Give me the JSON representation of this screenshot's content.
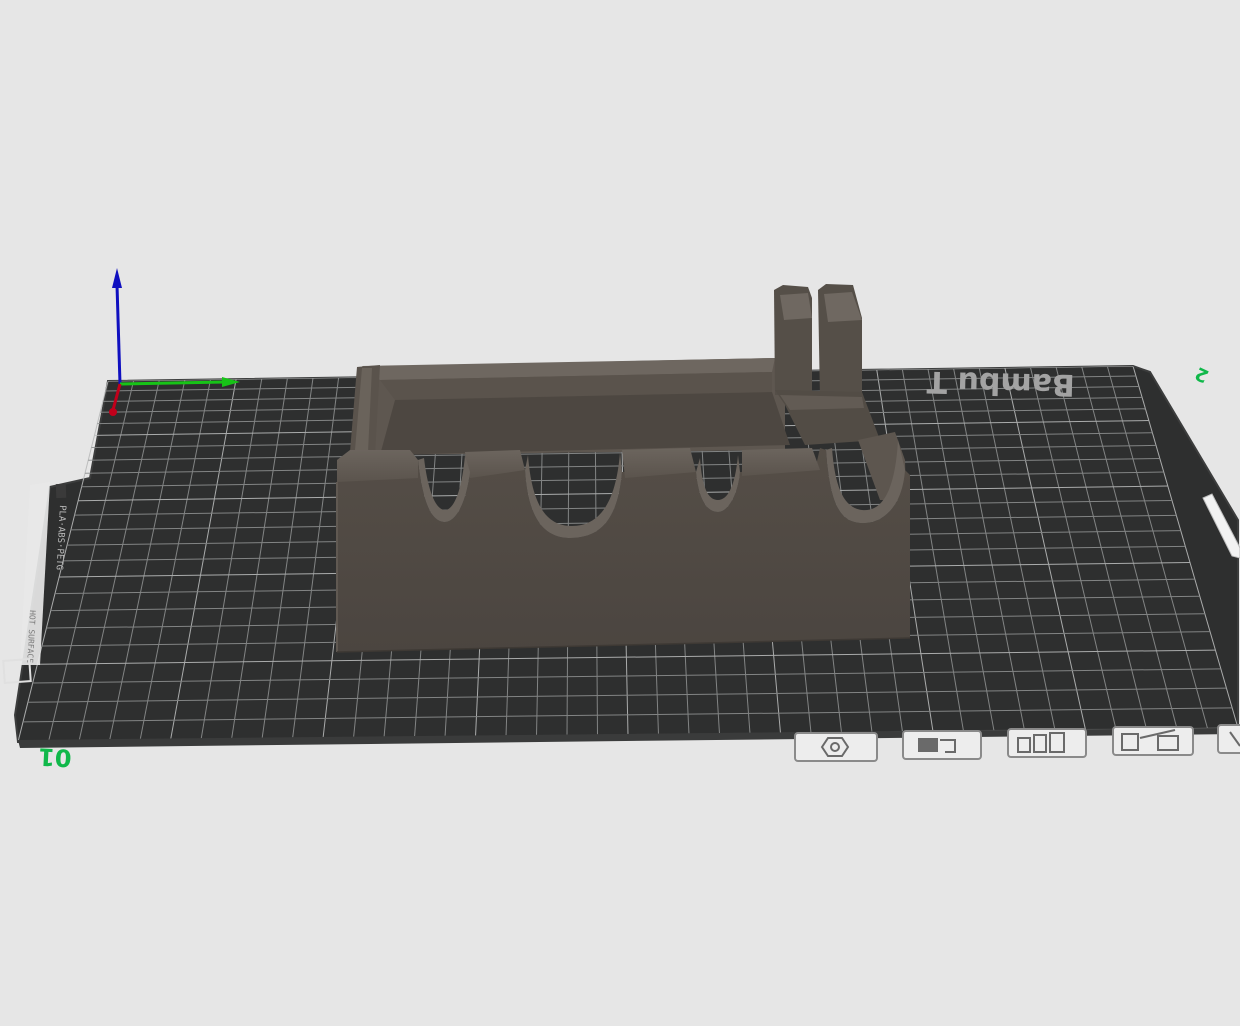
{
  "viewport": {
    "background": "#e6e6e6",
    "bed": {
      "surface_color": "#2e2f2f",
      "grid_color": "#8c8e8e",
      "brand_text": "Bambu T",
      "plate_label_types": "PLA·ABS·PETG",
      "plate_label_surface": "HOT SURFACE",
      "corner_number_front": "01",
      "corner_number_back": "2",
      "corner_number_color": "#10b84a"
    },
    "axes": {
      "x_color": "#c2001b",
      "y_color": "#17c417",
      "z_color": "#1010c0"
    },
    "model": {
      "name": "stand-model",
      "color": "#4f4943"
    },
    "plate_toolbar": {
      "icons": [
        "nut-icon",
        "pick-icon",
        "arrange-icon",
        "settings-icon",
        "close-icon"
      ]
    }
  }
}
